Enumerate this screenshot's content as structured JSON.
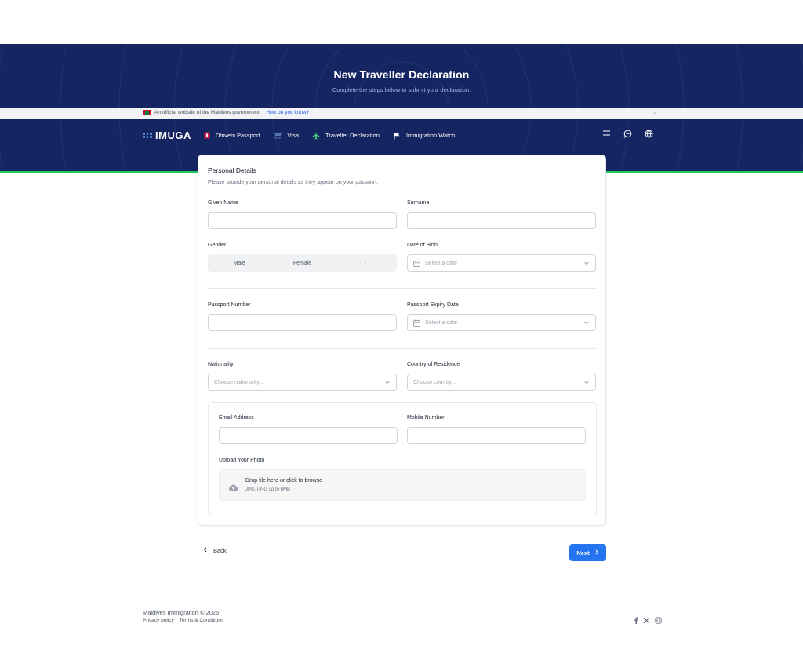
{
  "hero": {
    "title": "New Traveller Declaration",
    "subtitle": "Complete the steps below to submit your declaration."
  },
  "gov_banner": {
    "text": "An official website of the Maldives government.",
    "link": "How do you know?"
  },
  "nav": {
    "logo": "IMUGA",
    "items": [
      {
        "label": "Dhivehi Passport",
        "icon": "passport-icon"
      },
      {
        "label": "Visa",
        "icon": "visa-icon"
      },
      {
        "label": "Traveller Declaration",
        "icon": "plane-icon"
      },
      {
        "label": "Immigration Watch",
        "icon": "flag-icon"
      }
    ],
    "right_icons": [
      "menu-stack-icon",
      "chat-icon",
      "globe-icon"
    ]
  },
  "form": {
    "title": "Personal Details",
    "description": "Please provide your personal details as they appear on your passport.",
    "given_name_label": "Given Name",
    "surname_label": "Surname",
    "gender_label": "Gender",
    "gender_options": [
      "Male",
      "Female",
      "-"
    ],
    "dob_label": "Date of Birth",
    "dob_placeholder": "Select a date",
    "passport_number_label": "Passport Number",
    "passport_expiry_label": "Passport Expiry Date",
    "passport_expiry_placeholder": "Select a date",
    "nationality_label": "Nationality",
    "nationality_placeholder": "Choose nationality...",
    "residence_label": "Country of Residence",
    "residence_placeholder": "Choose country...",
    "email_label": "Email Address",
    "mobile_label": "Mobile Number",
    "upload_label": "Upload Your Photo",
    "upload_title": "Drop file here or click to browse",
    "upload_sub": "JPG, PNG up to 6MB"
  },
  "actions": {
    "back": "Back",
    "next": "Next"
  },
  "footer": {
    "copyright": "Maldives Immigration © 2026",
    "links": [
      "Privacy policy",
      "Terms & Conditions"
    ],
    "social": [
      "facebook-icon",
      "x-icon",
      "instagram-icon"
    ]
  },
  "colors": {
    "navy": "#142561",
    "accent_green": "#22c55e",
    "primary_blue": "#2574f0"
  }
}
